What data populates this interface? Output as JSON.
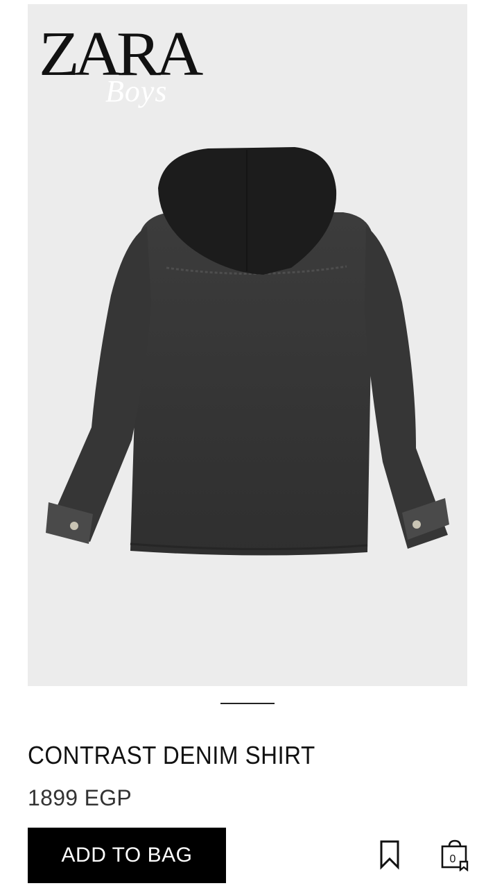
{
  "brand": {
    "logo_text": "ZARA",
    "logo_sub": "Boys"
  },
  "gallery": {
    "image_alt_icon": "hooded-denim-shirt-image",
    "dots": [
      {
        "active": false
      },
      {
        "active": false
      },
      {
        "active": false
      },
      {
        "active": true
      },
      {
        "active": false
      }
    ]
  },
  "product": {
    "title": "CONTRAST DENIM SHIRT",
    "price": "1899 EGP"
  },
  "actions": {
    "add_to_bag_label": "ADD TO BAG",
    "bookmark_icon": "bookmark-icon",
    "bag_icon": "shopping-bag-icon",
    "bag_count": "0"
  },
  "colors": {
    "background": "#ffffff",
    "photo_background": "#ececec",
    "button": "#000000",
    "button_text": "#ffffff"
  }
}
